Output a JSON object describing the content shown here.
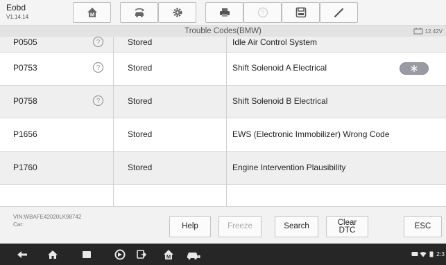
{
  "app": {
    "name": "Eobd",
    "version": "V1.14.14"
  },
  "toolbar": {
    "buttons": [
      {
        "icon": "home-m-icon"
      },
      {
        "icon": "vehicle-swap-icon"
      },
      {
        "icon": "settings-gear-icon"
      },
      {
        "icon": "printer-icon"
      },
      {
        "icon": "help-circle-icon",
        "disabled": true
      },
      {
        "icon": "save-icon"
      },
      {
        "icon": "pen-icon"
      }
    ]
  },
  "header": {
    "title": "Trouble Codes(BMW)",
    "battery_voltage": "12.42V"
  },
  "table": {
    "rows": [
      {
        "code": "P0505",
        "status": "Stored",
        "description": "Idle Air Control System",
        "help": true
      },
      {
        "code": "P0753",
        "status": "Stored",
        "description": "Shift Solenoid A Electrical",
        "help": true
      },
      {
        "code": "P0758",
        "status": "Stored",
        "description": "Shift Solenoid B Electrical",
        "help": true
      },
      {
        "code": "P1656",
        "status": "Stored",
        "description": "EWS (Electronic Immobilizer) Wrong Code",
        "help": false
      },
      {
        "code": "P1760",
        "status": "Stored",
        "description": "Engine Intervention Plausibility",
        "help": false
      }
    ]
  },
  "footer": {
    "vin": "VIN:WBAFE42020LK98742",
    "car": "Car:",
    "buttons": {
      "help": "Help",
      "freeze": "Freeze",
      "search": "Search",
      "clear_line1": "Clear",
      "clear_line2": "DTC",
      "esc": "ESC"
    }
  },
  "system_bar": {
    "clock": "2:3"
  }
}
